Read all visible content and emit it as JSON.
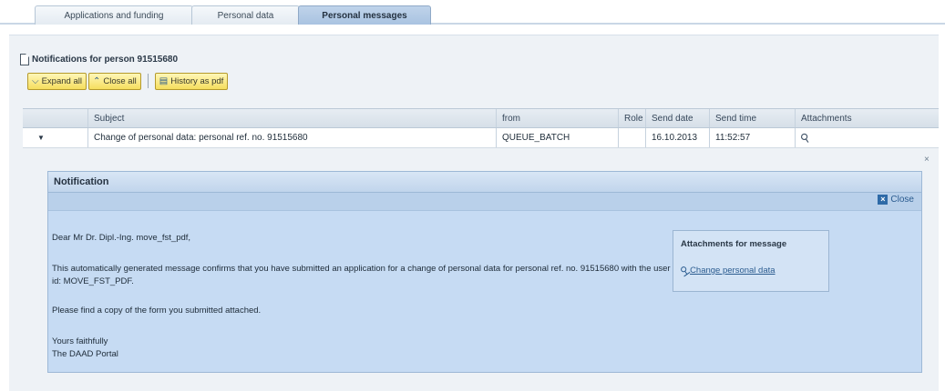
{
  "tabs": [
    {
      "label": "Applications and funding"
    },
    {
      "label": "Personal data"
    },
    {
      "label": "Personal messages"
    }
  ],
  "panel": {
    "title": "Notifications for person 91515680"
  },
  "toolbar": {
    "expand_all": "Expand all",
    "close_all": "Close all",
    "history_pdf": "History as pdf"
  },
  "table": {
    "headers": [
      "",
      "Subject",
      "from",
      "Role",
      "Send date",
      "Send time",
      "Attachments"
    ],
    "rows": [
      {
        "subject": "Change of personal data: personal ref. no. 91515680",
        "from": "QUEUE_BATCH",
        "role": "",
        "send_date": "16.10.2013",
        "send_time": "11:52:57"
      }
    ]
  },
  "notification": {
    "title": "Notification",
    "close_label": "Close",
    "greeting": "Dear Mr Dr. Dipl.-Ing. move_fst_pdf,",
    "body": "This automatically generated message confirms that you have submitted an application for a change of personal data for personal ref. no. 91515680 with the user id: MOVE_FST_PDF.",
    "copy_note": "Please find a copy of the form you submitted attached.",
    "closing_line1": "Yours faithfully",
    "closing_line2": "The DAAD Portal",
    "attachments_title": "Attachments for message",
    "attachment_link": "Change personal data"
  },
  "icons": {
    "doc": "document-icon",
    "expand": "expand-icon",
    "collapse": "collapse-icon",
    "pdf": "pdf-icon",
    "attachment": "paperclip-icon",
    "close": "close-icon"
  }
}
